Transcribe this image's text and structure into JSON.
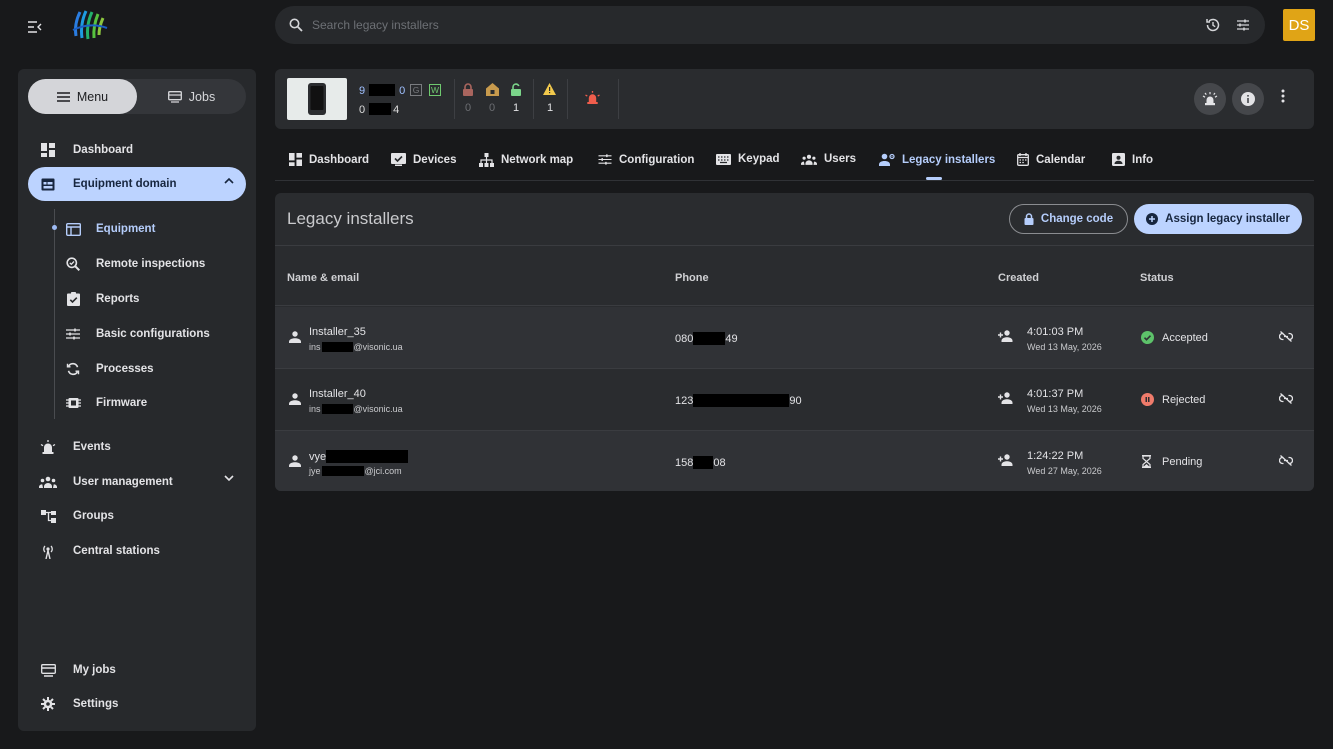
{
  "header": {
    "search": {
      "placeholder": "Search legacy installers"
    },
    "avatar_initials": "DS",
    "icons": [
      "menu-collapse-icon",
      "logo",
      "search-icon",
      "history-icon",
      "tune-icon"
    ]
  },
  "sidebar": {
    "segments": {
      "menu_label": "Menu",
      "jobs_label": "Jobs",
      "active": "Menu"
    },
    "items": {
      "dashboard": "Dashboard",
      "equipment_domain": "Equipment domain",
      "events": "Events",
      "user_management": "User management",
      "groups": "Groups",
      "central_stations": "Central stations",
      "my_jobs": "My jobs",
      "settings": "Settings"
    },
    "equipment_sub": {
      "equipment": "Equipment",
      "remote_inspections": "Remote inspections",
      "reports": "Reports",
      "basic_configurations": "Basic configurations",
      "processes": "Processes",
      "firmware": "Firmware"
    },
    "active_item": "Equipment"
  },
  "device": {
    "serial_start": "9",
    "serial_end": "0",
    "account_start": "0",
    "account_end": "4",
    "badge_g": "G",
    "badge_w": "W",
    "stats": {
      "armed_away": "0",
      "armed_home": "0",
      "disarmed": "1",
      "warnings": "1"
    },
    "colors": {
      "armed": "#a9655e",
      "home": "#c79a4d",
      "disarmed": "#7bd58a",
      "warning": "#f2c94c",
      "alarm": "#ef5d4c"
    }
  },
  "tabs": {
    "dashboard": "Dashboard",
    "devices": "Devices",
    "network_map": "Network map",
    "configuration": "Configuration",
    "keypad": "Keypad",
    "users": "Users",
    "legacy_installers": "Legacy installers",
    "calendar": "Calendar",
    "info": "Info",
    "active": "Legacy installers"
  },
  "panel": {
    "title": "Legacy installers",
    "change_code_label": "Change code",
    "assign_label": "Assign legacy installer",
    "columns": {
      "name": "Name & email",
      "phone": "Phone",
      "created": "Created",
      "status": "Status"
    },
    "rows": [
      {
        "name": "Installer_35",
        "email_start": "ins",
        "email_end": "@visonic.ua",
        "phone_start": "080",
        "phone_end": "49",
        "time": "4:01:03 PM",
        "date": "Wed 13 May, 2026",
        "status": "Accepted"
      },
      {
        "name": "Installer_40",
        "email_start": "ins",
        "email_end": "@visonic.ua",
        "phone_start": "123",
        "phone_end": "90",
        "time": "4:01:37 PM",
        "date": "Wed 13 May, 2026",
        "status": "Rejected"
      },
      {
        "name": "vye",
        "email_start": "jye",
        "email_end": "@jci.com",
        "phone_start": "158",
        "phone_end": "08",
        "time": "1:24:22 PM",
        "date": "Wed 27 May, 2026",
        "status": "Pending"
      }
    ],
    "status_colors": {
      "Accepted": "#5dc26a",
      "Rejected": "#ef7b6b",
      "Pending": "#e3e3e6"
    }
  }
}
